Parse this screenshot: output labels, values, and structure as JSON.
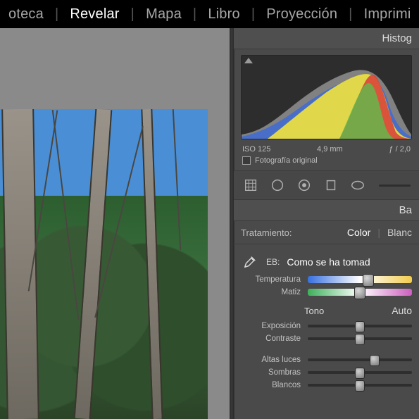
{
  "topbar": {
    "modules": [
      "oteca",
      "Revelar",
      "Mapa",
      "Libro",
      "Proyección",
      "Imprimi"
    ],
    "active_index": 1
  },
  "histogram": {
    "title": "Histog",
    "meta": {
      "iso": "ISO 125",
      "focal": "4,9 mm",
      "aperture": "ƒ / 2,0"
    },
    "original_checkbox_label": "Fotografía original"
  },
  "tools": {
    "names": [
      "crop",
      "spot",
      "redeye",
      "graduated",
      "radial",
      "brush"
    ]
  },
  "basic": {
    "section_title": "Ba",
    "treatment_label": "Tratamiento:",
    "treat_color": "Color",
    "treat_bw": "Blanc",
    "wb_short": "EB:",
    "wb_value": "Como se ha tomad",
    "temp_label": "Temperatura",
    "tint_label": "Matiz",
    "tone_header": "Tono",
    "auto_label": "Auto",
    "exposure_label": "Exposición",
    "contrast_label": "Contraste",
    "highlights_label": "Altas luces",
    "shadows_label": "Sombras",
    "whites_label": "Blancos"
  }
}
